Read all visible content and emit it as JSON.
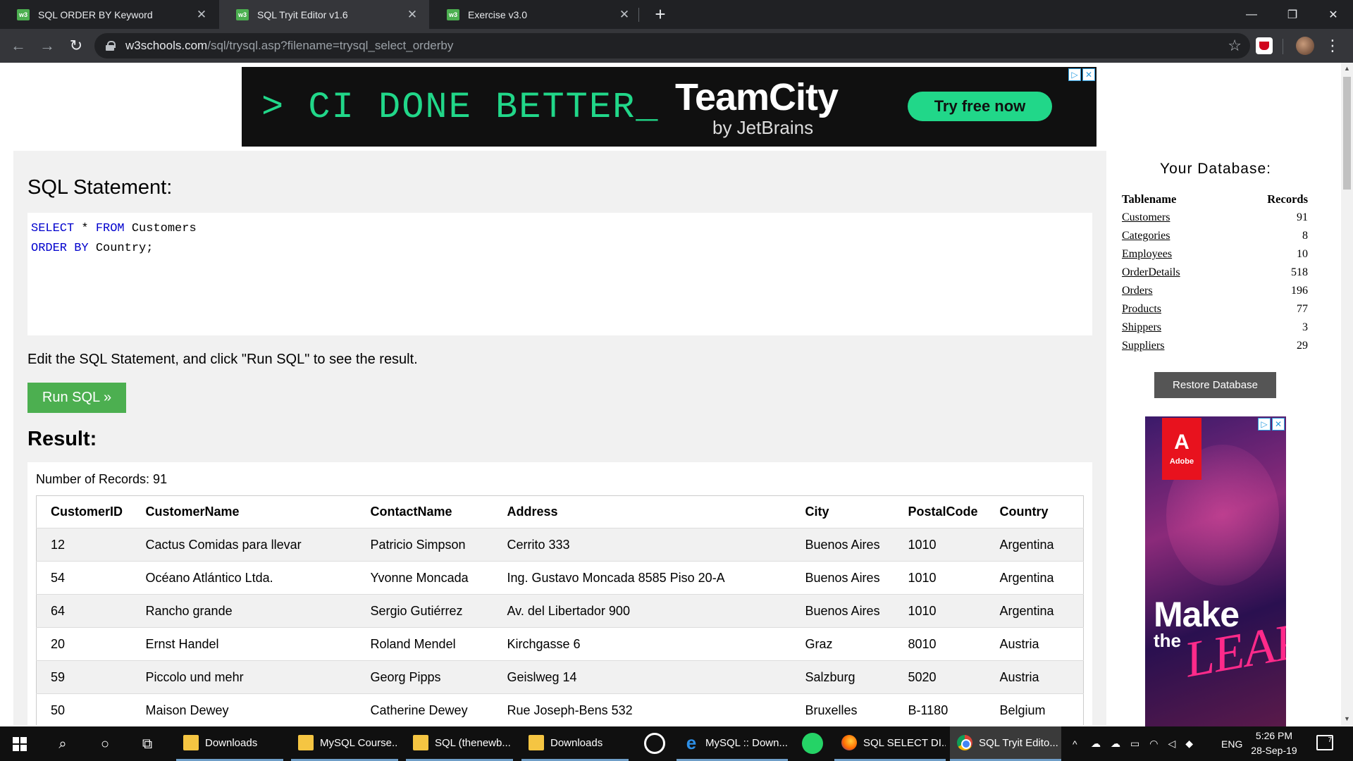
{
  "browser": {
    "tabs": [
      {
        "favicon": "w3",
        "title": "SQL ORDER BY Keyword",
        "active": false
      },
      {
        "favicon": "w3",
        "title": "SQL Tryit Editor v1.6",
        "active": true
      },
      {
        "favicon": "w3",
        "title": "Exercise v3.0",
        "active": false
      }
    ],
    "tab_close_glyph": "✕",
    "new_tab_glyph": "+",
    "window_controls": {
      "minimize": "—",
      "restore": "❐",
      "close": "✕"
    },
    "nav": {
      "back": "←",
      "forward": "→",
      "reload": "↻"
    },
    "url_host": "w3schools.com",
    "url_path": "/sql/trysql.asp?filename=trysql_select_orderby",
    "bookmark_glyph": "☆",
    "menu_glyph": "⋮"
  },
  "top_ad": {
    "slogan": "> CI DONE BETTER_",
    "brand": "TeamCity",
    "brand_sub": "by JetBrains",
    "cta": "Try free now",
    "choices_info": "▷",
    "choices_close": "✕"
  },
  "editor": {
    "heading": "SQL Statement:",
    "line1_kw1": "SELECT",
    "line1_mid": " * ",
    "line1_kw2": "FROM",
    "line1_rest": " Customers",
    "line2_kw": "ORDER BY",
    "line2_rest": " Country;",
    "help_text": "Edit the SQL Statement, and click \"Run SQL\" to see the result.",
    "run_button": "Run SQL »"
  },
  "result": {
    "heading": "Result:",
    "records_line": "Number of Records: 91",
    "columns": [
      "CustomerID",
      "CustomerName",
      "ContactName",
      "Address",
      "City",
      "PostalCode",
      "Country"
    ],
    "rows": [
      [
        "12",
        "Cactus Comidas para llevar",
        "Patricio Simpson",
        "Cerrito 333",
        "Buenos Aires",
        "1010",
        "Argentina"
      ],
      [
        "54",
        "Océano Atlántico Ltda.",
        "Yvonne Moncada",
        "Ing. Gustavo Moncada 8585 Piso 20-A",
        "Buenos Aires",
        "1010",
        "Argentina"
      ],
      [
        "64",
        "Rancho grande",
        "Sergio Gutiérrez",
        "Av. del Libertador 900",
        "Buenos Aires",
        "1010",
        "Argentina"
      ],
      [
        "20",
        "Ernst Handel",
        "Roland Mendel",
        "Kirchgasse 6",
        "Graz",
        "8010",
        "Austria"
      ],
      [
        "59",
        "Piccolo und mehr",
        "Georg Pipps",
        "Geislweg 14",
        "Salzburg",
        "5020",
        "Austria"
      ],
      [
        "50",
        "Maison Dewey",
        "Catherine Dewey",
        "Rue Joseph-Bens 532",
        "Bruxelles",
        "B-1180",
        "Belgium"
      ]
    ]
  },
  "sidebar": {
    "title": "Your Database:",
    "col_table": "Tablename",
    "col_records": "Records",
    "tables": [
      {
        "name": "Customers",
        "records": "91"
      },
      {
        "name": "Categories",
        "records": "8"
      },
      {
        "name": "Employees",
        "records": "10"
      },
      {
        "name": "OrderDetails",
        "records": "518"
      },
      {
        "name": "Orders",
        "records": "196"
      },
      {
        "name": "Products",
        "records": "77"
      },
      {
        "name": "Shippers",
        "records": "3"
      },
      {
        "name": "Suppliers",
        "records": "29"
      }
    ],
    "restore_button": "Restore Database"
  },
  "side_ad": {
    "logo_word": "Adobe",
    "logo_glyph": "A",
    "headline_1": "Make",
    "headline_2": "the",
    "headline_3": "LEAP",
    "choices_info": "▷",
    "choices_close": "✕"
  },
  "taskbar": {
    "search_glyph": "⌕",
    "cortana_glyph": "○",
    "taskview_glyph": "⧉",
    "apps": [
      {
        "label": "Downloads",
        "icon": "folder-icon"
      },
      {
        "label": "MySQL Course...",
        "icon": "folder-icon"
      },
      {
        "label": "SQL (thenewb...",
        "icon": "folder-icon"
      },
      {
        "label": "Downloads",
        "icon": "folder-icon"
      },
      {
        "label": "MySQL :: Down...",
        "icon": "edge-icon"
      },
      {
        "label": "SQL SELECT DI...",
        "icon": "firefox-icon"
      },
      {
        "label": "SQL Tryit Edito...",
        "icon": "chrome-icon"
      }
    ],
    "tray_chevron": "^",
    "language": "ENG",
    "time": "5:26 PM",
    "date": "28-Sep-19",
    "notification_count": "7"
  }
}
